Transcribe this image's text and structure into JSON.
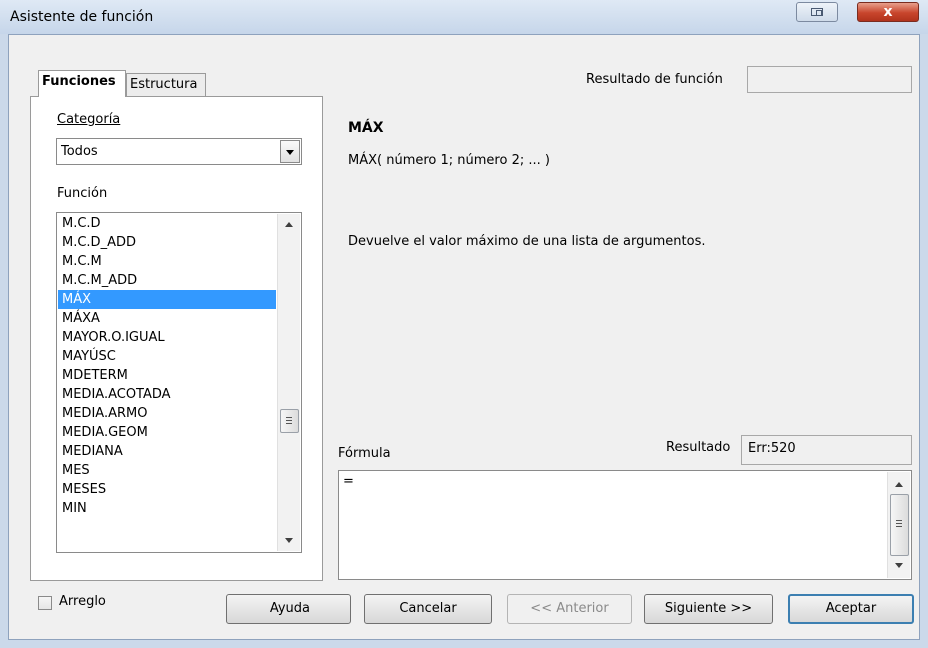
{
  "window": {
    "title": "Asistente de función",
    "close_glyph": "x"
  },
  "tabs": [
    {
      "label": "Funciones",
      "active": true
    },
    {
      "label": "Estructura",
      "active": false
    }
  ],
  "category": {
    "label": "Categoría",
    "selected": "Todos"
  },
  "function_list": {
    "label": "Función",
    "items": [
      "M.C.D",
      "M.C.D_ADD",
      "M.C.M",
      "M.C.M_ADD",
      "MÁX",
      "MÁXA",
      "MAYOR.O.IGUAL",
      "MAYÚSC",
      "MDETERM",
      "MEDIA.ACOTADA",
      "MEDIA.ARMO",
      "MEDIA.GEOM",
      "MEDIANA",
      "MES",
      "MESES",
      "MIN"
    ],
    "selected": "MÁX"
  },
  "function_result": {
    "label": "Resultado de función",
    "value": ""
  },
  "selected_function": {
    "name": "MÁX",
    "syntax": "MÁX( número 1; número 2; ... )",
    "description": "Devuelve el valor máximo de una lista de argumentos."
  },
  "formula": {
    "label": "Fórmula",
    "value": "="
  },
  "result": {
    "label": "Resultado",
    "value": "Err:520"
  },
  "array_option": {
    "label": "Arreglo",
    "checked": false
  },
  "buttons": {
    "help": "Ayuda",
    "cancel": "Cancelar",
    "back": "<< Anterior",
    "next": "Siguiente >>",
    "ok": "Aceptar"
  },
  "colors": {
    "selection": "#3399ff",
    "close_button": "#c8452c",
    "default_button_border": "#3c7fb1"
  }
}
